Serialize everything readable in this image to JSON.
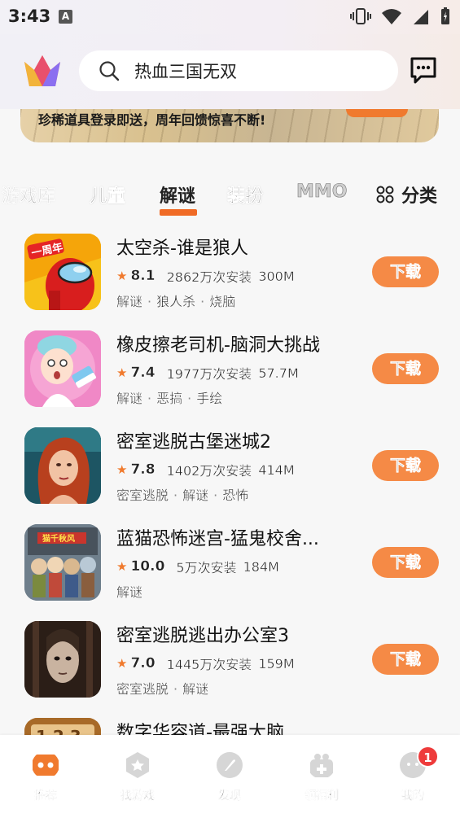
{
  "status_bar": {
    "time": "3:43",
    "indicator": "A"
  },
  "search": {
    "placeholder": "热血三国无双"
  },
  "banner": {
    "text": "珍稀道具登录即送，周年回馈惊喜不断!"
  },
  "tabs": [
    {
      "label": "游戏库"
    },
    {
      "label": "儿童"
    },
    {
      "label": "解谜",
      "active": true
    },
    {
      "label": "装扮"
    },
    {
      "label": "MMO"
    }
  ],
  "category_label": "分类",
  "games": [
    {
      "title": "太空杀-谁是狼人",
      "rating": "8.1",
      "installs": "2862万次安装",
      "size": "300M",
      "tags": [
        "解谜",
        "狼人杀",
        "烧脑"
      ],
      "button": "下载",
      "icon_label": "一周年"
    },
    {
      "title": "橡皮擦老司机-脑洞大挑战",
      "rating": "7.4",
      "installs": "1977万次安装",
      "size": "57.7M",
      "tags": [
        "解谜",
        "恶搞",
        "手绘"
      ],
      "button": "下载"
    },
    {
      "title": "密室逃脱古堡迷城2",
      "rating": "7.8",
      "installs": "1402万次安装",
      "size": "414M",
      "tags": [
        "密室逃脱",
        "解谜",
        "恐怖"
      ],
      "button": "下载"
    },
    {
      "title": "蓝猫恐怖迷宫-猛鬼校舍...",
      "rating": "10.0",
      "installs": "5万次安装",
      "size": "184M",
      "tags": [
        "解谜"
      ],
      "button": "下载",
      "icon_label": "猫千秋风"
    },
    {
      "title": "密室逃脱逃出办公室3",
      "rating": "7.0",
      "installs": "1445万次安装",
      "size": "159M",
      "tags": [
        "密室逃脱",
        "解谜"
      ],
      "button": "下载"
    },
    {
      "title": "数字华容道-最强大脑",
      "icon_label": "1 2 3"
    }
  ],
  "bottom_nav": [
    {
      "label": "推荐",
      "active": true
    },
    {
      "label": "找游戏"
    },
    {
      "label": "发现"
    },
    {
      "label": "领福利"
    },
    {
      "label": "我的"
    }
  ],
  "badge_count": "1",
  "colors": {
    "accent": "#f06b26",
    "button": "#f58a46",
    "badge": "#ee3b3b"
  }
}
